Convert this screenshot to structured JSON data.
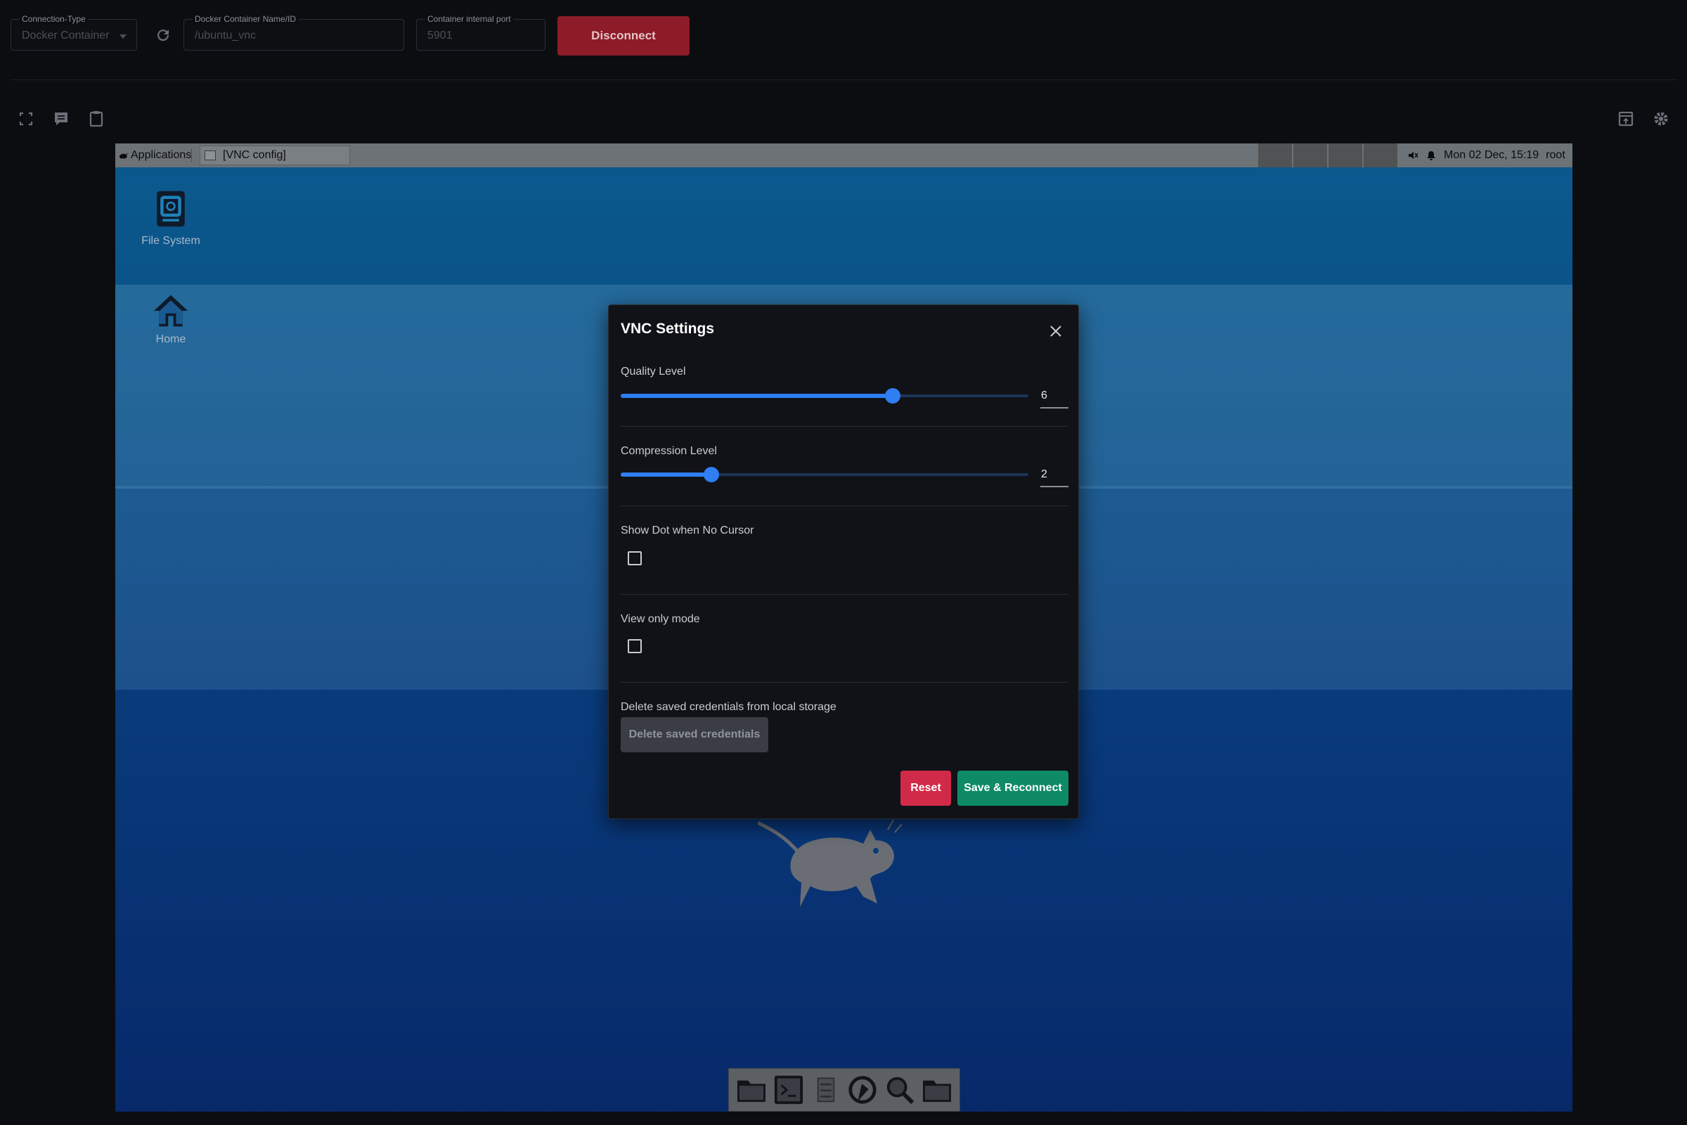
{
  "connection": {
    "type_label": "Connection-Type",
    "type_value": "Docker Container",
    "container_label": "Docker Container Name/ID",
    "container_value": "/ubuntu_vnc",
    "port_label": "Container internal port",
    "port_value": "5901",
    "disconnect_label": "Disconnect"
  },
  "toolbar": {
    "left_icons": [
      "fullscreen-icon",
      "chat-icon",
      "clipboard-icon"
    ],
    "right_icons": [
      "popout-icon",
      "gear-icon"
    ]
  },
  "desktop": {
    "panel": {
      "applications": "Applications",
      "task_title": "[VNC config]",
      "clock": "Mon 02 Dec, 15:19",
      "user": "root"
    },
    "icons": [
      {
        "label": "File System"
      },
      {
        "label": "Home"
      }
    ],
    "dock_icons": [
      "folder-icon",
      "terminal-icon",
      "server-icon",
      "browser-icon",
      "magnifier-icon",
      "folder-icon"
    ]
  },
  "modal": {
    "title": "VNC Settings",
    "quality": {
      "label": "Quality Level",
      "value": "6",
      "min": 0,
      "max": 9,
      "level": 6
    },
    "compression": {
      "label": "Compression Level",
      "value": "2",
      "min": 0,
      "max": 9,
      "level": 2
    },
    "show_dot": {
      "label": "Show Dot when No Cursor",
      "checked": false
    },
    "view_only": {
      "label": "View only mode",
      "checked": false
    },
    "delete": {
      "label": "Delete saved credentials from local storage",
      "button": "Delete saved credentials"
    },
    "reset_label": "Reset",
    "save_label": "Save & Reconnect"
  },
  "colors": {
    "accent": "#2f7ef2",
    "danger": "#d02a48",
    "success": "#0e8a66",
    "disconnect": "#8c1c28"
  }
}
